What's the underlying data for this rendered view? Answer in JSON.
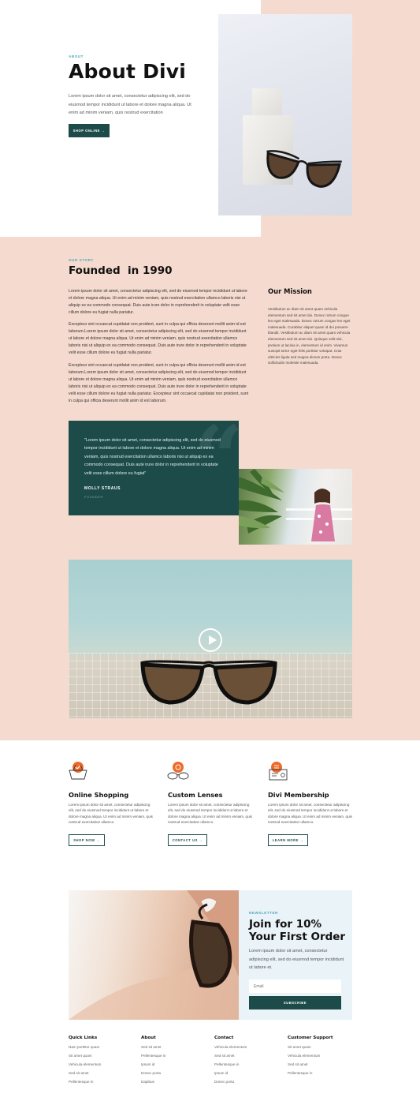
{
  "hero": {
    "eyebrow": "ABOUT",
    "title": "About Divi",
    "text": "Lorem ipsum dolor sit amet, consectetur adipiscing elit, sed do eiusmod tempor incididunt ut labore et dolore magna aliqua. Ut enim ad minim veniam, quis nostrud exercitation",
    "button": "SHOP ONLINE →"
  },
  "story": {
    "eyebrow": "OUR STORY",
    "title": "Founded  in 1990",
    "p1": "Lorem ipsum dolor sit amet, consectetur adipiscing elit, sed do eiusmod tempor incididunt ut labore et dolore magna aliqua. Ut enim ad minim veniam, quis nostrud exercitation ullamco laboris nisi ut aliquip ex ea commodo consequat. Duis aute irure dolor in reprehenderit in voluptate velit esse cillum dolore eu fugiat nulla pariatur.",
    "p2": "Excepteur sint occaecat cupidatat non proident, sunt in culpa qui officia deserunt mollit anim id est laborum.Lorem ipsum dolor sit amet, consectetur adipiscing elit, sed do eiusmod tempor incididunt ut labore et dolore magna aliqua. Ut enim ad minim veniam, quis nostrud exercitation ullamco laboris nisi ut aliquip ex ea commodo consequat. Duis aute irure dolor in reprehenderit in voluptate velit esse cillum dolore eu fugiat nulla pariatur.",
    "p3": "Excepteur sint occaecat cupidatat non proident, sunt in culpa qui officia deserunt mollit anim id est laborum.Lorem ipsum dolor sit amet, consectetur adipiscing elit, sed do eiusmod tempor incididunt ut labore et dolore magna aliqua. Ut enim ad minim veniam, quis nostrud exercitation ullamco laboris nisi ut aliquip ex ea commodo consequat. Duis aute irure dolor in reprehenderit in voluptate velit esse cillum dolore eu fugiat nulla pariatur. Excepteur sint occaecat cupidatat non proident, sunt in culpa qui officia deserunt mollit anim id est laborum.",
    "mission_title": "Our Mission",
    "mission_text": "Vestibulum ac diam sit amet quam vehicula elementum sed sit amet dui. Donec rutrum congue leo eget malesuada. Donec rutrum congue leo eget malesuada. Curabitur aliquet quam id dui posuere blandit. Vestibulum ac diam sit amet quam vehicula elementum sed sit amet dui. Quisque velit nisi, pretium ut lacinia in, elementum id enim. Vivamus suscipit tortor eget felis porttitor volutpat. Cras ultricies ligula sed magna dictum porta. Donec sollicitudin molestie malesuada."
  },
  "quote": {
    "text": "\"Lorem ipsum dolor sit amet, consectetur adipiscing elit, sed do eiusmod tempor incididunt ut labore et dolore magna aliqua. Ut enim ad minim veniam, quis nostrud exercitation ullamco laboris nisi ut aliquip ex ea commodo consequat. Duis aute irure dolor in reprehenderit in voluptate velit esse cillum dolore eu fugiat\"",
    "name": "MOLLY STRAUS",
    "role": "FOUNDER"
  },
  "features": [
    {
      "icon": "basket-icon",
      "title": "Online Shopping",
      "text": "Lorem ipsum dolor sit amet, consectetur adipiscing elit, sed do eiusmod tempor incididunt ut labore et dolore magna aliqua. Ut enim ad minim veniam, quis nostrud exercitation ullamco.",
      "button": "SHOP NOW →"
    },
    {
      "icon": "glasses-icon",
      "title": "Custom Lenses",
      "text": "Lorem ipsum dolor sit amet, consectetur adipiscing elit, sed do eiusmod tempor incididunt ut labore et dolore magna aliqua. Ut enim ad minim veniam, quis nostrud exercitation ullamco.",
      "button": "CONTACT US →"
    },
    {
      "icon": "membership-card-icon",
      "title": "Divi Membership",
      "text": "Lorem ipsum dolor sit amet, consectetur adipiscing elit, sed do eiusmod tempor incididunt ut labore et dolore magna aliqua. Ut enim ad minim veniam, quis nostrud exercitation ullamco.",
      "button": "LEARN MORE →"
    }
  ],
  "newsletter": {
    "eyebrow": "NEWSLETTER",
    "title": "Join for 10% Your First Order",
    "text": "Lorem ipsum dolor sit amet, consectetur adipiscing elit, sed do eiusmod tempor incididunt ut labore et.",
    "email_placeholder": "Email",
    "button": "SUBSCRIBE"
  },
  "footer": [
    {
      "title": "Quick Links",
      "links": [
        "Nam porttitor quam",
        "Sit amet quam",
        "Vehicula elementum",
        "Sed sit amet",
        "Pellentesque in"
      ]
    },
    {
      "title": "About",
      "links": [
        "Sed sit amet",
        "Pellentesque in",
        "Ipsum id",
        "Donec porta",
        "Dapibus"
      ]
    },
    {
      "title": "Contact",
      "links": [
        "Vehicula elementum",
        "Sed sit amet",
        "Pellentesque in",
        "Ipsum id",
        "Donec porta"
      ]
    },
    {
      "title": "Customer Support",
      "links": [
        "Sit amet quam",
        "Vehicula elementum",
        "Sed sit amet",
        "Pellentesque in"
      ]
    }
  ],
  "colors": {
    "peach": "#f5dbcf",
    "teal_dark": "#1c4b4a",
    "accent_orange": "#ee6a2a",
    "eyebrow_blue": "#4aa5b8",
    "newsletter_bg": "#eaf3f7"
  }
}
